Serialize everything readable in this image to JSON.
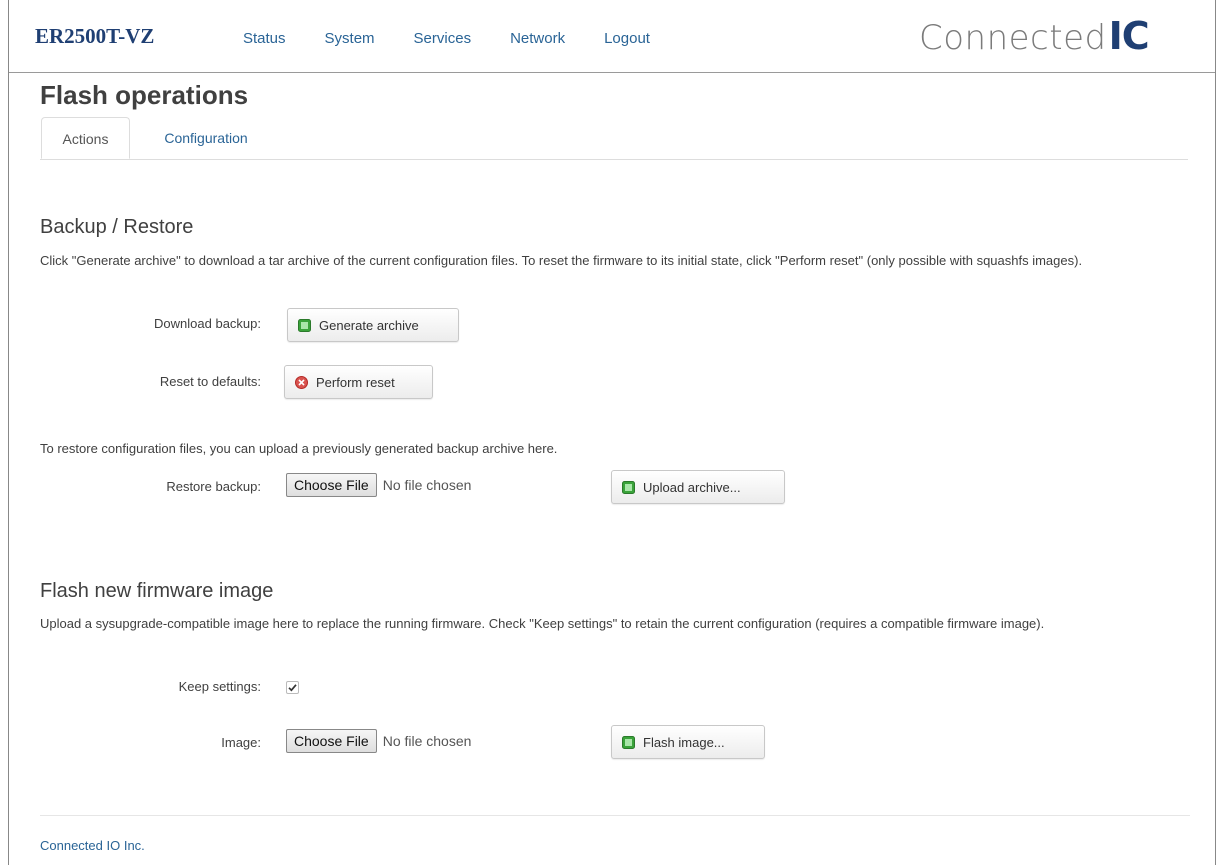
{
  "brand": "ER2500T-VZ",
  "nav": [
    "Status",
    "System",
    "Services",
    "Network",
    "Logout"
  ],
  "logo": {
    "text": "Connected",
    "mark": "IC"
  },
  "page_title": "Flash operations",
  "tabs": [
    {
      "label": "Actions",
      "active": true
    },
    {
      "label": "Configuration",
      "active": false
    }
  ],
  "backup": {
    "title": "Backup / Restore",
    "description": "Click \"Generate archive\" to download a tar archive of the current configuration files. To reset the firmware to its initial state, click \"Perform reset\" (only possible with squashfs images).",
    "download_label": "Download backup:",
    "generate_button": "Generate archive",
    "reset_label": "Reset to defaults:",
    "reset_button": "Perform reset",
    "restore_description": "To restore configuration files, you can upload a previously generated backup archive here.",
    "restore_label": "Restore backup:",
    "choose_file": "Choose File",
    "no_file": "No file chosen",
    "upload_button": "Upload archive..."
  },
  "flash": {
    "title": "Flash new firmware image",
    "description": "Upload a sysupgrade-compatible image here to replace the running firmware. Check \"Keep settings\" to retain the current configuration (requires a compatible firmware image).",
    "keep_label": "Keep settings:",
    "keep_checked": true,
    "image_label": "Image:",
    "choose_file": "Choose File",
    "no_file": "No file chosen",
    "flash_button": "Flash image..."
  },
  "footer": "Connected IO Inc.",
  "colors": {
    "brand": "#1f3f73",
    "link": "#2a6496",
    "apply_icon": "#3aa33a",
    "reset_icon": "#d9534f"
  },
  "icons": [
    "apply-icon",
    "reset-icon",
    "checkmark-icon"
  ]
}
